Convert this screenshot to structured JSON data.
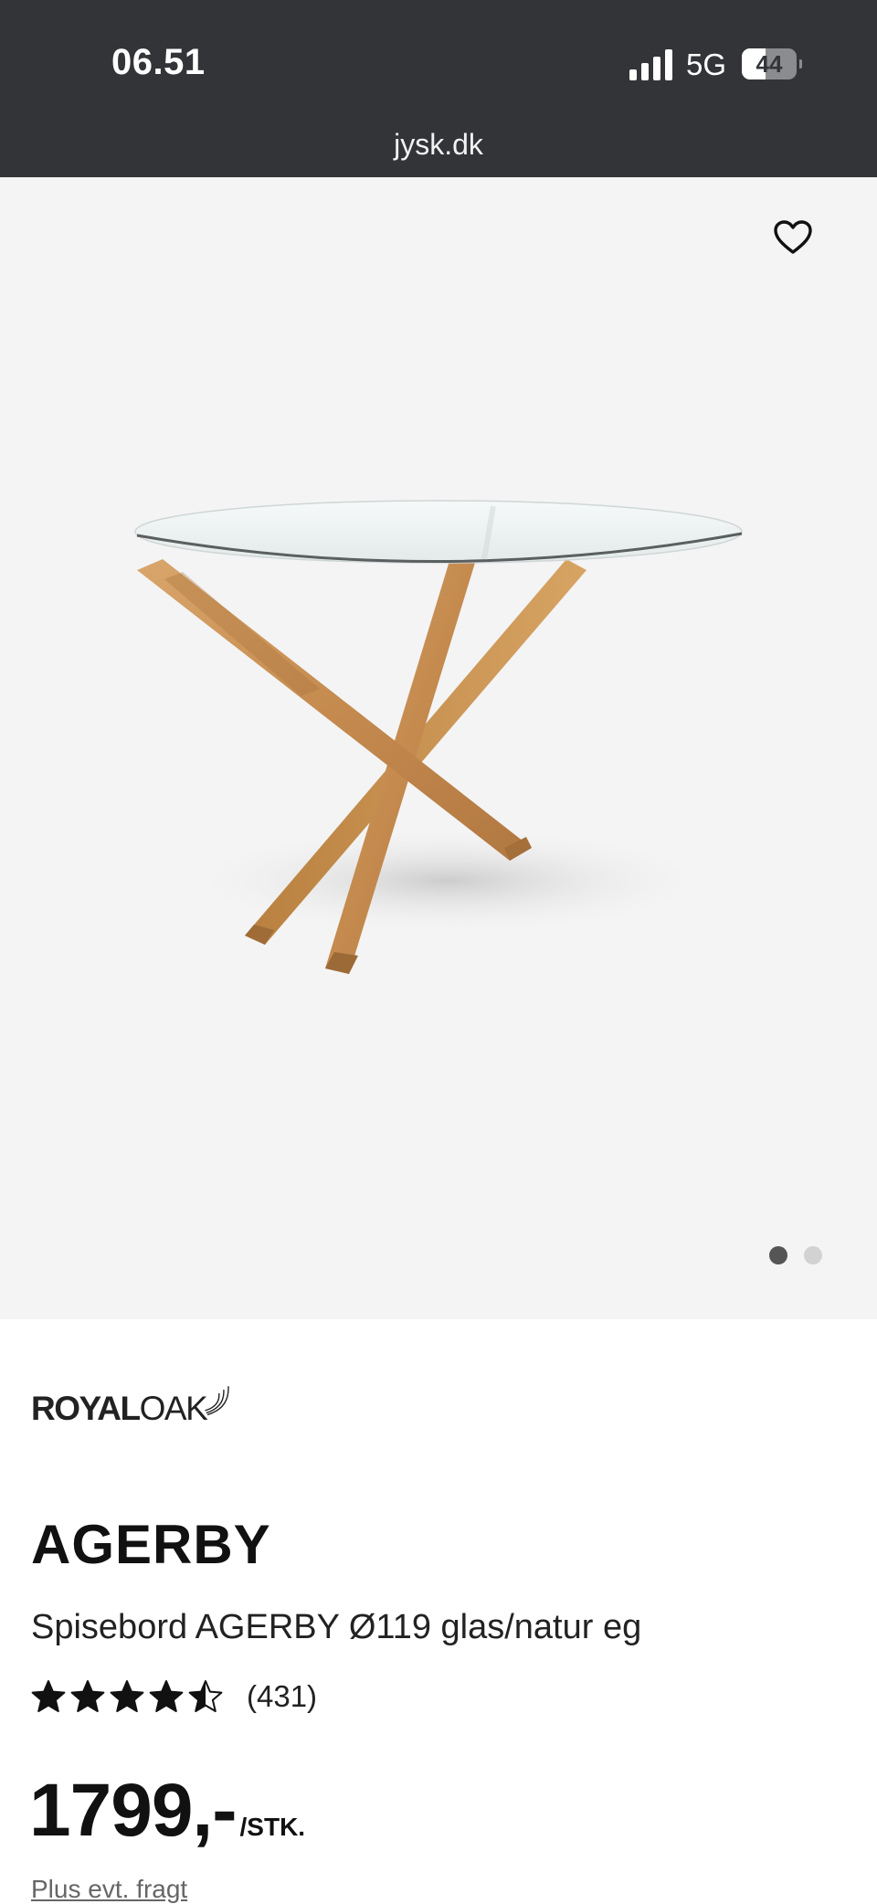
{
  "status_bar": {
    "time": "06.51",
    "network": "5G",
    "battery_level": "44",
    "battery_fraction": 0.44
  },
  "browser": {
    "url": "jysk.dk"
  },
  "gallery": {
    "favorite_icon": "heart-outline-icon",
    "image_alt": "AGERBY dining table with glass top and crossed oak legs",
    "slide_count": 2,
    "active_slide": 1
  },
  "product": {
    "brand": {
      "part1": "ROYAL",
      "part2": "OAK"
    },
    "name": "AGERBY",
    "description": "Spisebord AGERBY Ø119 glas/natur eg",
    "rating": 4.5,
    "review_count": "(431)",
    "price": "1799,-",
    "unit": "/STK.",
    "freight_note": "Plus evt. fragt"
  },
  "colors": {
    "status_bar_bg": "#323438",
    "gallery_bg": "#f4f4f4",
    "text": "#111111",
    "muted": "#666666"
  }
}
